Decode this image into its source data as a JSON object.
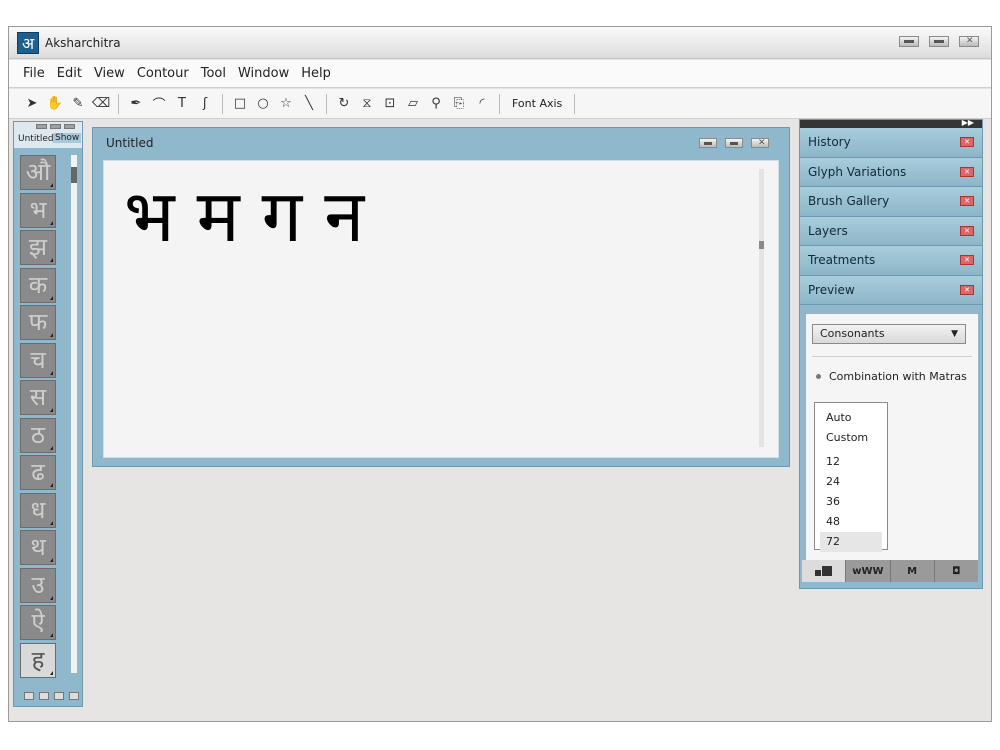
{
  "app": {
    "logo": "अ",
    "title": "Aksharchitra"
  },
  "menu": [
    "File",
    "Edit",
    "View",
    "Contour",
    "Tool",
    "Window",
    "Help"
  ],
  "toolbar": {
    "tools": [
      {
        "name": "select-tool-icon",
        "glyph": "➤"
      },
      {
        "name": "hand-tool-icon",
        "glyph": "✋"
      },
      {
        "name": "brush-tool-icon",
        "glyph": "✎"
      },
      {
        "name": "eraser-tool-icon",
        "glyph": "⌫"
      },
      {
        "name": "pen-tool-icon",
        "glyph": "✒"
      },
      {
        "name": "curve-tool-icon",
        "glyph": "⌒"
      },
      {
        "name": "t-stroke-tool-icon",
        "glyph": "T"
      },
      {
        "name": "hook-stroke-tool-icon",
        "glyph": "ʃ"
      },
      {
        "name": "rectangle-tool-icon",
        "glyph": "□"
      },
      {
        "name": "ellipse-tool-icon",
        "glyph": "○"
      },
      {
        "name": "star-tool-icon",
        "glyph": "☆"
      },
      {
        "name": "line-tool-icon",
        "glyph": "╲"
      },
      {
        "name": "rotate-tool-icon",
        "glyph": "↻"
      },
      {
        "name": "mirror-tool-icon",
        "glyph": "⧖"
      },
      {
        "name": "scale-tool-icon",
        "glyph": "⊡"
      },
      {
        "name": "skew-tool-icon",
        "glyph": "▱"
      },
      {
        "name": "zoom-tool-icon",
        "glyph": "⚲"
      },
      {
        "name": "copy-tool-icon",
        "glyph": "⎘"
      },
      {
        "name": "corner-tool-icon",
        "glyph": "◜"
      }
    ],
    "font_axis": "Font Axis"
  },
  "glyph_panel": {
    "tab_untitled": "Untitled",
    "tab_show": "Show",
    "glyphs": [
      "औ",
      "भ",
      "झ",
      "क",
      "फ",
      "च",
      "स",
      "ठ",
      "ढ",
      "ध",
      "थ",
      "उ",
      "ऐ",
      "ह"
    ]
  },
  "document": {
    "title": "Untitled",
    "text": "भमगन"
  },
  "right_panel": {
    "sections": [
      "History",
      "Glyph Variations",
      "Brush Gallery",
      "Layers",
      "Treatments",
      "Preview"
    ],
    "preview": {
      "select_value": "Consonants",
      "combination": "Combination with Matras",
      "size_modes": [
        "Auto",
        "Custom"
      ],
      "sizes": [
        "12",
        "24",
        "36",
        "48",
        "72"
      ],
      "selected_size": "72",
      "bar_buttons": [
        "",
        "wWW",
        "M",
        "◘"
      ]
    }
  }
}
